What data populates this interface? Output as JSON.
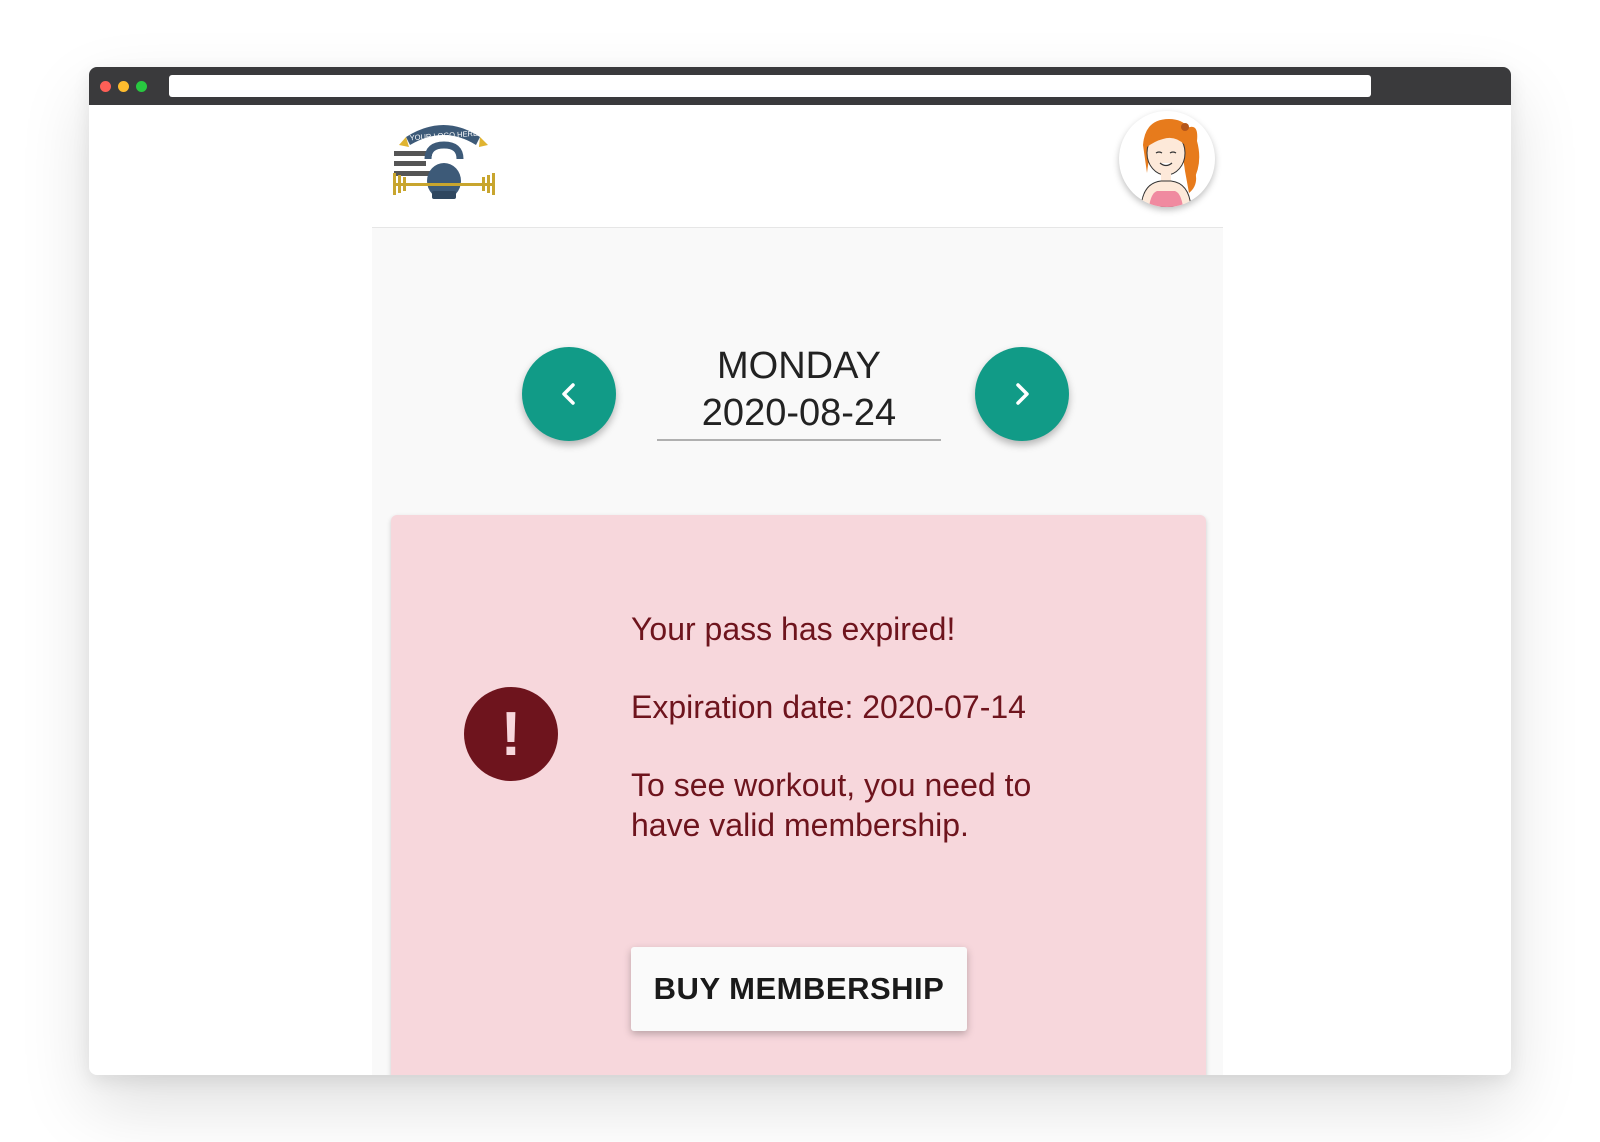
{
  "browser": {
    "traffic_lights": [
      "#fe5f57",
      "#febc2e",
      "#28c840"
    ],
    "url": ""
  },
  "header": {
    "logo_text": "YOUR LOGO HERE",
    "logo_icon": "kettlebell-barbell-logo",
    "avatar_icon": "user-avatar-cartoon"
  },
  "date_nav": {
    "day": "MONDAY",
    "date": "2020-08-24",
    "prev_icon": "chevron-left-icon",
    "next_icon": "chevron-right-icon",
    "accent_color": "#119b87"
  },
  "alert": {
    "icon": "exclamation-icon",
    "title": "Your pass has expired!",
    "expiration": "Expiration date: 2020-07-14",
    "message": "To see workout, you need to have valid membership.",
    "button_label": "BUY MEMBERSHIP",
    "background_color": "#f7d7dc",
    "text_color": "#6e141d"
  }
}
